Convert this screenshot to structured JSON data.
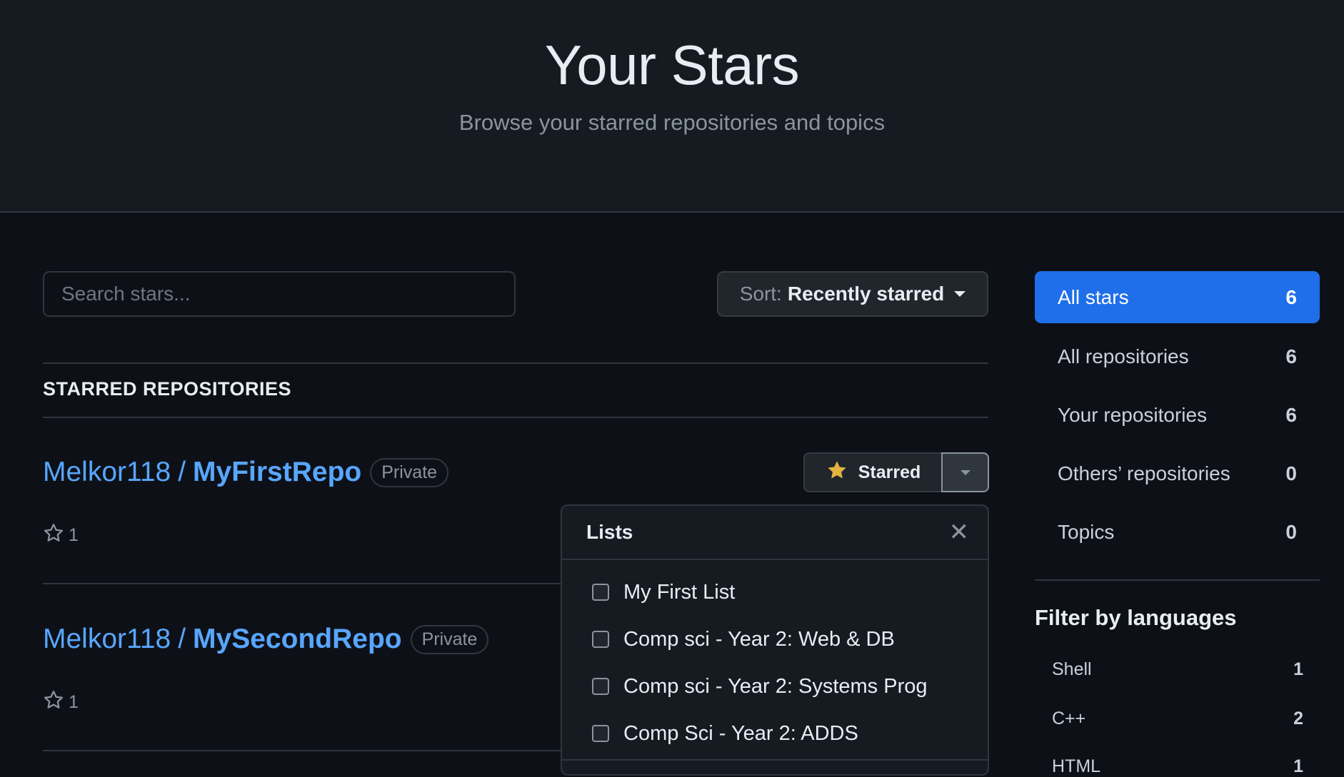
{
  "header": {
    "title": "Your Stars",
    "subtitle": "Browse your starred repositories and topics"
  },
  "search": {
    "placeholder": "Search stars...",
    "value": ""
  },
  "sort": {
    "prefix": "Sort:",
    "value": "Recently starred"
  },
  "section": {
    "label": "STARRED REPOSITORIES"
  },
  "repos": [
    {
      "owner": "Melkor118",
      "separator": "/",
      "name": "MyFirstRepo",
      "visibility": "Private",
      "stars": "1"
    },
    {
      "owner": "Melkor118",
      "separator": "/",
      "name": "MySecondRepo",
      "visibility": "Private",
      "stars": "1"
    }
  ],
  "starred_button": {
    "label": "Starred"
  },
  "lists_popover": {
    "title": "Lists",
    "close_icon": "close-icon",
    "items": [
      {
        "label": "My First List",
        "checked": false
      },
      {
        "label": "Comp sci - Year 2: Web & DB",
        "checked": false
      },
      {
        "label": "Comp sci - Year 2: Systems Prog",
        "checked": false
      },
      {
        "label": "Comp Sci - Year 2: ADDS",
        "checked": false
      }
    ]
  },
  "sidebar": {
    "items": [
      {
        "label": "All stars",
        "count": "6",
        "active": true
      },
      {
        "label": "All repositories",
        "count": "6",
        "active": false
      },
      {
        "label": "Your repositories",
        "count": "6",
        "active": false
      },
      {
        "label": "Others’ repositories",
        "count": "0",
        "active": false
      },
      {
        "label": "Topics",
        "count": "0",
        "active": false
      }
    ]
  },
  "languages": {
    "title": "Filter by languages",
    "items": [
      {
        "name": "Shell",
        "count": "1"
      },
      {
        "name": "C++",
        "count": "2"
      },
      {
        "name": "HTML",
        "count": "1"
      }
    ]
  },
  "colors": {
    "background": "#0d1117",
    "header_background": "#161b22",
    "link": "#58a6ff",
    "active_accent": "#1f6feb",
    "star": "#e3b341"
  }
}
